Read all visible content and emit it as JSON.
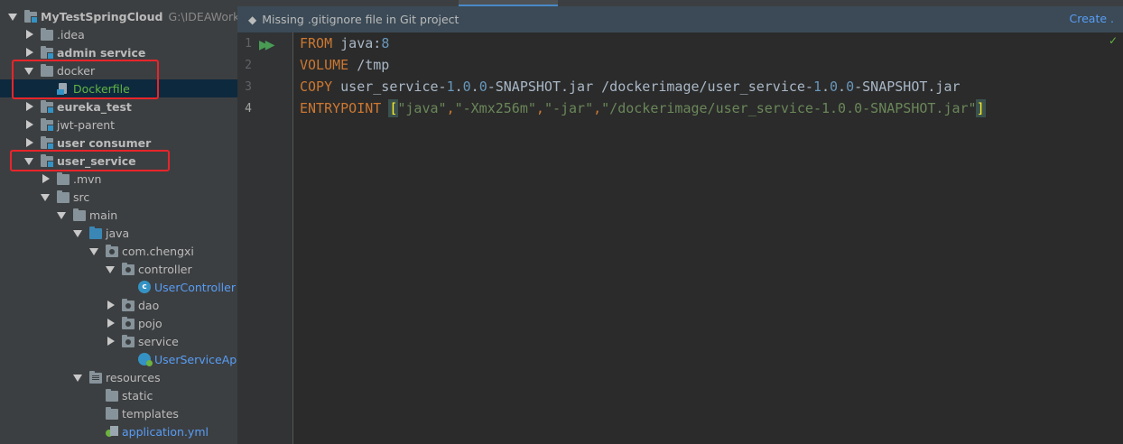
{
  "sidebar": {
    "tree": [
      {
        "label": "MyTestSpringCloud",
        "path": "G:\\IDEAWorkSa",
        "level": 0,
        "state": "open",
        "icon": "module-folder-icon",
        "style": "bold"
      },
      {
        "label": ".idea",
        "level": 1,
        "state": "closed",
        "icon": "folder-icon",
        "style": "normal"
      },
      {
        "label": "admin service",
        "level": 1,
        "state": "closed",
        "icon": "module-folder-icon",
        "style": "bold"
      },
      {
        "label": "docker",
        "level": 1,
        "state": "open",
        "icon": "folder-icon",
        "style": "normal"
      },
      {
        "label": "Dockerfile",
        "level": 2,
        "state": "none",
        "icon": "dockerfile-icon",
        "style": "green",
        "selected": true
      },
      {
        "label": "eureka_test",
        "level": 1,
        "state": "closed",
        "icon": "module-folder-icon",
        "style": "bold"
      },
      {
        "label": "jwt-parent",
        "level": 1,
        "state": "closed",
        "icon": "module-folder-icon",
        "style": "normal"
      },
      {
        "label": "user consumer",
        "level": 1,
        "state": "closed",
        "icon": "module-folder-icon",
        "style": "bold"
      },
      {
        "label": "user_service",
        "level": 1,
        "state": "open",
        "icon": "module-folder-icon",
        "style": "bold"
      },
      {
        "label": ".mvn",
        "level": 2,
        "state": "closed",
        "icon": "folder-icon",
        "style": "normal"
      },
      {
        "label": "src",
        "level": 2,
        "state": "open",
        "icon": "folder-icon",
        "style": "normal"
      },
      {
        "label": "main",
        "level": 3,
        "state": "open",
        "icon": "folder-icon",
        "style": "normal"
      },
      {
        "label": "java",
        "level": 4,
        "state": "open",
        "icon": "source-folder-icon",
        "style": "normal"
      },
      {
        "label": "com.chengxi",
        "level": 5,
        "state": "open",
        "icon": "package-icon",
        "style": "normal"
      },
      {
        "label": "controller",
        "level": 6,
        "state": "open",
        "icon": "package-icon",
        "style": "normal"
      },
      {
        "label": "UserController",
        "level": 7,
        "state": "none",
        "icon": "class-icon",
        "style": "blue"
      },
      {
        "label": "dao",
        "level": 6,
        "state": "closed",
        "icon": "package-icon",
        "style": "normal"
      },
      {
        "label": "pojo",
        "level": 6,
        "state": "closed",
        "icon": "package-icon",
        "style": "normal"
      },
      {
        "label": "service",
        "level": 6,
        "state": "closed",
        "icon": "package-icon",
        "style": "normal"
      },
      {
        "label": "UserServiceApplica",
        "level": 7,
        "state": "none",
        "icon": "spring-app-icon",
        "style": "blue"
      },
      {
        "label": "resources",
        "level": 4,
        "state": "open",
        "icon": "resources-folder-icon",
        "style": "normal"
      },
      {
        "label": "static",
        "level": 5,
        "state": "none",
        "icon": "folder-icon",
        "style": "normal"
      },
      {
        "label": "templates",
        "level": 5,
        "state": "none",
        "icon": "folder-icon",
        "style": "normal"
      },
      {
        "label": "application.yml",
        "level": 5,
        "state": "none",
        "icon": "yml-icon",
        "style": "blue"
      }
    ]
  },
  "editor": {
    "notification": {
      "icon": "git-icon",
      "text": "Missing .gitignore file in Git project",
      "action": "Create ."
    },
    "line_numbers": [
      "1",
      "2",
      "3",
      "4"
    ],
    "current_line": "4",
    "code_lines": [
      [
        {
          "t": "FROM",
          "c": "kw"
        },
        {
          "t": " java:",
          "c": ""
        },
        {
          "t": "8",
          "c": "num"
        }
      ],
      [
        {
          "t": "VOLUME",
          "c": "kw"
        },
        {
          "t": " /tmp",
          "c": ""
        }
      ],
      [
        {
          "t": "COPY",
          "c": "kw"
        },
        {
          "t": " user_service-",
          "c": ""
        },
        {
          "t": "1",
          "c": "num"
        },
        {
          "t": ".",
          "c": ""
        },
        {
          "t": "0",
          "c": "num"
        },
        {
          "t": ".",
          "c": ""
        },
        {
          "t": "0",
          "c": "num"
        },
        {
          "t": "-SNAPSHOT.jar /dockerimage/user_service-",
          "c": ""
        },
        {
          "t": "1",
          "c": "num"
        },
        {
          "t": ".",
          "c": ""
        },
        {
          "t": "0",
          "c": "num"
        },
        {
          "t": ".",
          "c": ""
        },
        {
          "t": "0",
          "c": "num"
        },
        {
          "t": "-SNAPSHOT.jar",
          "c": ""
        }
      ],
      [
        {
          "t": "ENTRYPOINT",
          "c": "kw"
        },
        {
          "t": " ",
          "c": ""
        },
        {
          "t": "[",
          "c": "br-match"
        },
        {
          "t": "\"java\"",
          "c": "str"
        },
        {
          "t": ",",
          "c": "kw"
        },
        {
          "t": "\"-Xmx256m\"",
          "c": "str"
        },
        {
          "t": ",",
          "c": "kw"
        },
        {
          "t": "\"-jar\"",
          "c": "str"
        },
        {
          "t": ",",
          "c": "kw"
        },
        {
          "t": "\"/dockerimage/user_service-1.0.0-SNAPSHOT.jar\"",
          "c": "str"
        },
        {
          "t": "]",
          "c": "br-match"
        }
      ]
    ],
    "status_check": "✓"
  }
}
